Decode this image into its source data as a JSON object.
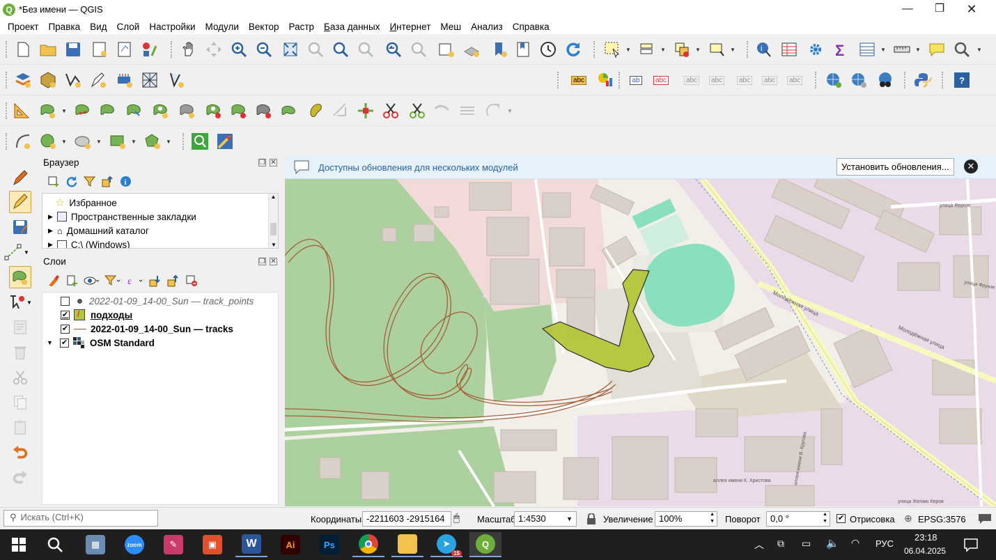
{
  "window": {
    "title": "*Без имени — QGIS",
    "minimize": "—",
    "maximize": "❐",
    "close": "✕"
  },
  "menu": [
    "Проект",
    "Правка",
    "Вид",
    "Слой",
    "Настройки",
    "Модули",
    "Вектор",
    "Растр",
    "База данных",
    "Интернет",
    "Меш",
    "Анализ",
    "Справка"
  ],
  "toolbar_labels": {
    "abc": "abc",
    "ab": "ab",
    "help": "?"
  },
  "browser": {
    "title": "Браузер",
    "items": [
      {
        "label": "Избранное",
        "icon": "star-icon"
      },
      {
        "label": "Пространственные закладки",
        "icon": "bookmark-icon"
      },
      {
        "label": "Домашний каталог",
        "icon": "home-folder-icon"
      },
      {
        "label": "C:\\ (Windows)",
        "icon": "drive-icon"
      }
    ]
  },
  "layers": {
    "title": "Слои",
    "items": [
      {
        "label": "2022-01-09_14-00_Sun — track_points",
        "checked": false,
        "style": "italic"
      },
      {
        "label": "подходы",
        "checked": true,
        "style": "bold-underline"
      },
      {
        "label": "2022-01-09_14-00_Sun — tracks",
        "checked": true,
        "style": "bold"
      },
      {
        "label": "OSM Standard",
        "checked": true,
        "style": "bold"
      }
    ]
  },
  "message_bar": {
    "text": "Доступны обновления для нескольких модулей",
    "button": "Установить обновления..."
  },
  "map_labels": {
    "street1": "Молодёжная улица",
    "street2": "Молодёжная улица",
    "street3": "улица Фрунзе",
    "street4": "улица Фрунзе",
    "street5": "аллея имени К. Христова",
    "street6": "аллея имени В. Кругова",
    "street7": "улица Желаю Керов"
  },
  "status": {
    "search_placeholder": "Искать (Ctrl+K)",
    "coords_label": "Координаты",
    "coords_value": "-2211603  -2915164",
    "scale_label": "Масштаб",
    "scale_value": "1:4530",
    "magnifier_label": "Увеличение",
    "magnifier_value": "100%",
    "rotation_label": "Поворот",
    "rotation_value": "0,0 °",
    "render_label": "Отрисовка",
    "crs": "EPSG:3576"
  },
  "taskbar": {
    "zoom_label": "zoom",
    "ai_label": "Ai",
    "ps_label": "Ps",
    "tg_badge": "15",
    "lang": "РУС",
    "time": "23:18",
    "date": "06.04.2025"
  },
  "colors": {
    "accent": "#2a6fb8",
    "polygon": "#b5c63a",
    "forest": "#add19e",
    "track": "#a0522d",
    "taskbar": "#1f1f1f"
  }
}
